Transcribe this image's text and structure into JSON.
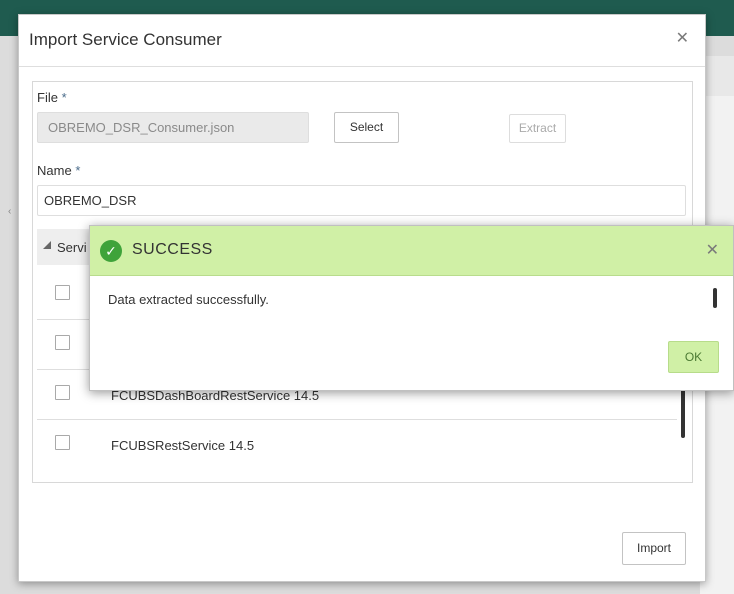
{
  "dialog": {
    "title": "Import Service Consumer",
    "close_icon": "close-icon"
  },
  "form": {
    "file_label": "File",
    "file_value": "OBREMO_DSR_Consumer.json",
    "required_mark": "*",
    "select_label": "Select",
    "extract_label": "Extract",
    "name_label": "Name",
    "name_value": "OBREMO_DSR"
  },
  "table": {
    "column_header": "Servi",
    "rows": [
      {
        "label": ""
      },
      {
        "label": ""
      },
      {
        "label": "FCUBSDashBoardRestService 14.5"
      },
      {
        "label": "FCUBSRestService 14.5"
      }
    ]
  },
  "import_label": "Import",
  "success_dialog": {
    "title": "SUCCESS",
    "message": "Data extracted successfully.",
    "ok_label": "OK",
    "close_icon": "close-icon",
    "status_icon": "check-circle-icon"
  },
  "colors": {
    "success_header": "#d0f0a6",
    "success_check": "#3fa33a",
    "top_bar": "#1f5b4f"
  }
}
